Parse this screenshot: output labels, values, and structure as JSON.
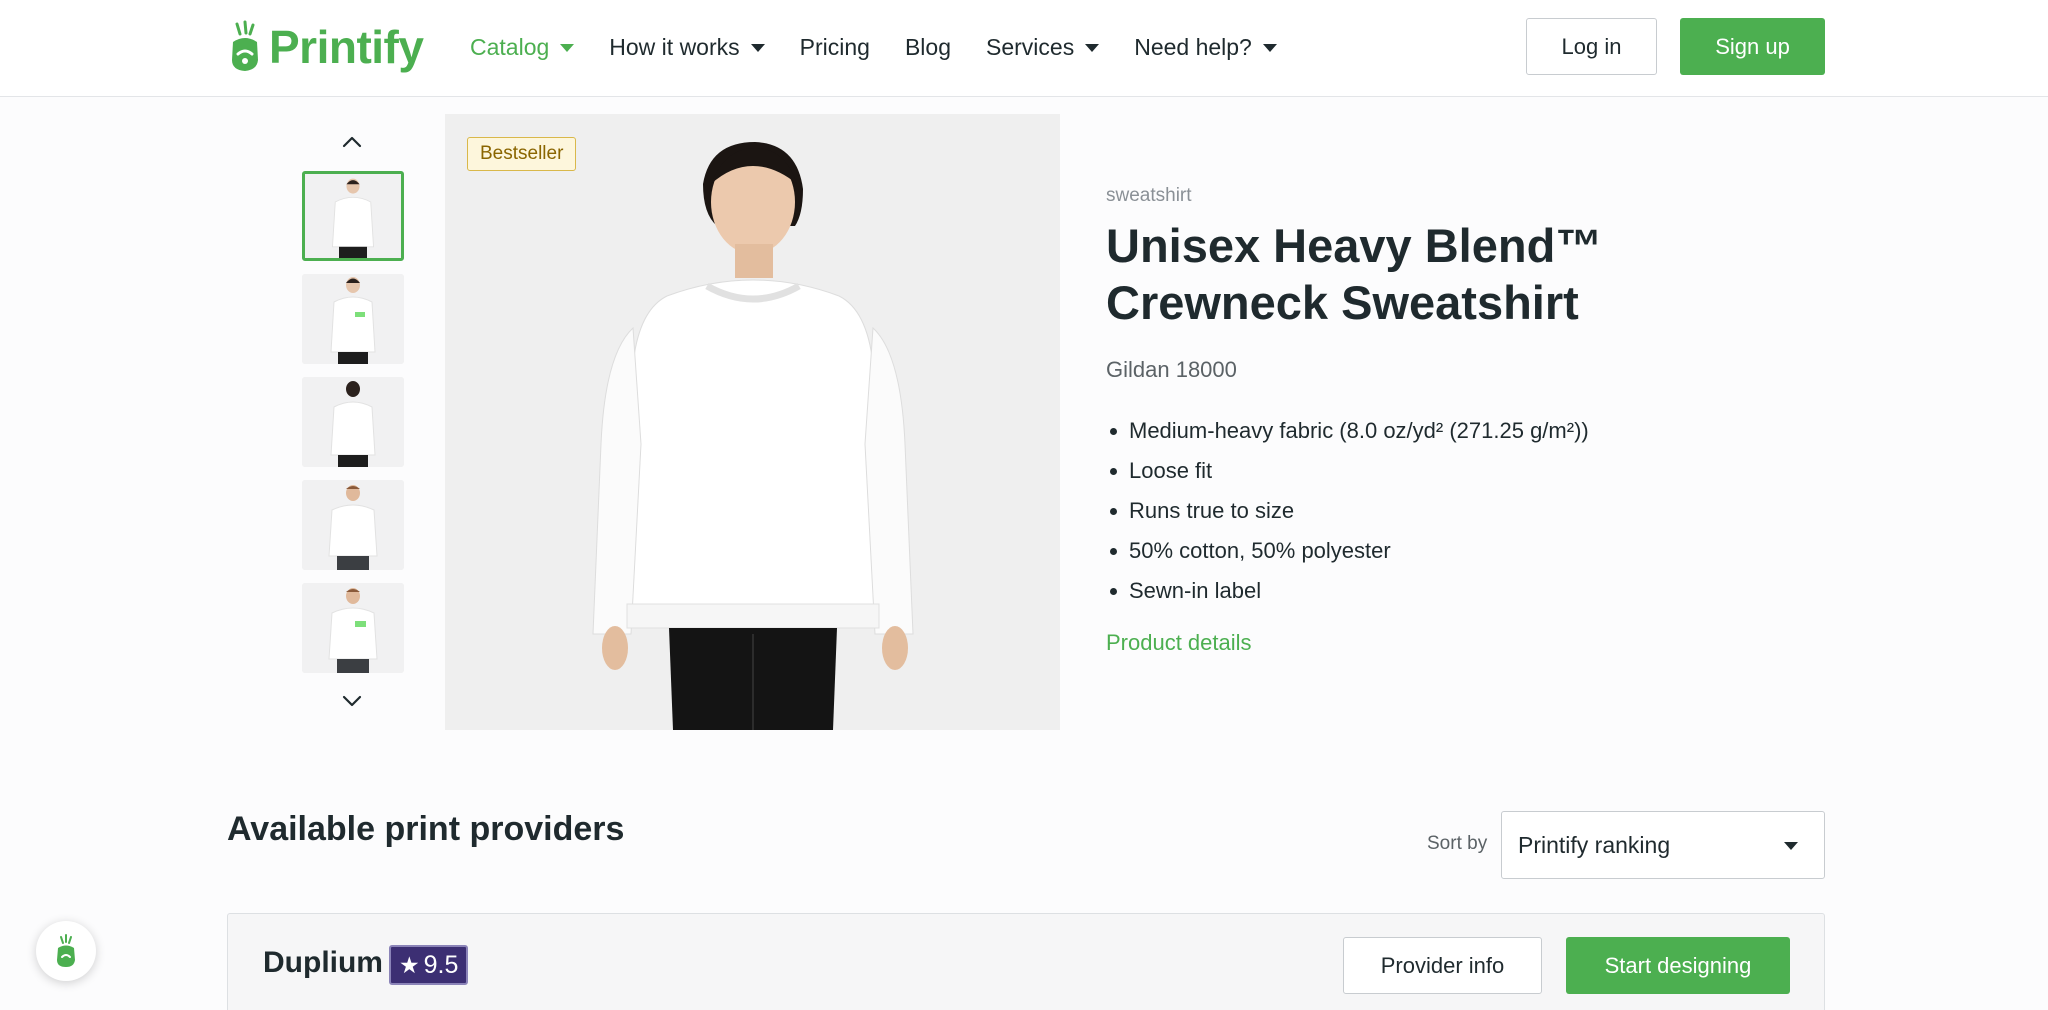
{
  "header": {
    "logo_text": "Printify",
    "nav": [
      {
        "label": "Catalog",
        "has_dropdown": true,
        "active": true
      },
      {
        "label": "How it works",
        "has_dropdown": true,
        "active": false
      },
      {
        "label": "Pricing",
        "has_dropdown": false,
        "active": false
      },
      {
        "label": "Blog",
        "has_dropdown": false,
        "active": false
      },
      {
        "label": "Services",
        "has_dropdown": true,
        "active": false
      },
      {
        "label": "Need help?",
        "has_dropdown": true,
        "active": false
      }
    ],
    "login_label": "Log in",
    "signup_label": "Sign up"
  },
  "gallery": {
    "badge": "Bestseller",
    "thumbnails": [
      {
        "icon": "model-woman-front",
        "selected": true
      },
      {
        "icon": "model-woman-front-print",
        "selected": false
      },
      {
        "icon": "model-woman-back",
        "selected": false
      },
      {
        "icon": "model-man-front",
        "selected": false
      },
      {
        "icon": "model-man-front-print",
        "selected": false
      }
    ]
  },
  "product": {
    "category": "sweatshirt",
    "title": "Unisex Heavy Blend™ Crewneck Sweatshirt",
    "model": "Gildan 18000",
    "features": [
      "Medium-heavy fabric (8.0 oz/yd² (271.25 g/m²))",
      "Loose fit",
      "Runs true to size",
      "50% cotton, 50% polyester",
      "Sewn-in label"
    ],
    "details_link": "Product details"
  },
  "providers": {
    "heading": "Available print providers",
    "sort_label": "Sort by",
    "sort_value": "Printify ranking",
    "items": [
      {
        "name": "Duplium",
        "rating": "9.5",
        "info_label": "Provider info",
        "start_label": "Start designing"
      }
    ]
  },
  "colors": {
    "brand_green": "#4caf50",
    "rating_purple": "#3c2f73",
    "badge_bg": "#fdf6dc"
  }
}
